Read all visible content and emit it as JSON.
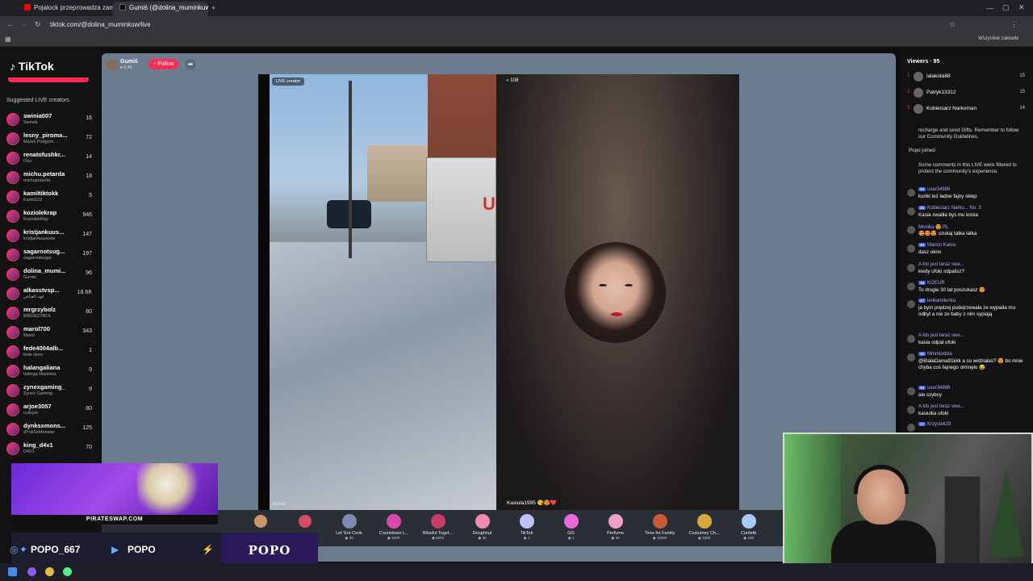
{
  "browser": {
    "tabs": [
      {
        "title": "Pojalock przeprowadza zamach...",
        "color": "#ff0000"
      },
      {
        "title": "Gumiś (@dolina_muminkuw)...",
        "color": "#000000"
      }
    ],
    "url": "tiktok.com/@dolina_muminkuw/live",
    "bookmarks_label": "Wszystkie zakładki"
  },
  "brand": {
    "logo": "TikTok",
    "accent": "#fe2c55"
  },
  "sidebar": {
    "title": "Suggested LIVE creators",
    "creators": [
      {
        "name": "swinia007",
        "sub": "Swinek",
        "count": "16"
      },
      {
        "name": "lesny_piroma...",
        "sub": "Marek Podgóm...",
        "count": "72"
      },
      {
        "name": "renatofushkr...",
        "sub": "Ooo",
        "count": "14"
      },
      {
        "name": "michu.petarda",
        "sub": "michupetarda",
        "count": "18"
      },
      {
        "name": "kamiltiktokk",
        "sub": "Kamil123",
        "count": "5"
      },
      {
        "name": "koziolekrap",
        "sub": "KoziolekRap",
        "count": "946"
      },
      {
        "name": "kristjankuus...",
        "sub": "kristjankuuseste",
        "count": "147"
      },
      {
        "name": "sagarnotsug...",
        "sub": "sagarnotsugar",
        "count": "197"
      },
      {
        "name": "dolina_mumi...",
        "sub": "Gumiś",
        "count": "96"
      },
      {
        "name": "alkasstvsp...",
        "sub": "فهد القناص",
        "count": "18.6K"
      },
      {
        "name": "mrgrzybolz",
        "sub": "MRGRZYBOL",
        "count": "80"
      },
      {
        "name": "marol700",
        "sub": "Marol",
        "count": "343"
      },
      {
        "name": "fede4004alb...",
        "sub": "fede vlore",
        "count": "1"
      },
      {
        "name": "halangaliana",
        "sub": "halinga Marinela",
        "count": "9"
      },
      {
        "name": "zynexgaming_",
        "sub": "Zynex Gaming",
        "count": "9"
      },
      {
        "name": "arjoe3057",
        "sub": "ᴄᴀArjoe",
        "count": "80"
      },
      {
        "name": "dynksxmons...",
        "sub": "dYnkSxMonster",
        "count": "125"
      },
      {
        "name": "king_d4v1",
        "sub": "D4V1",
        "count": "70"
      }
    ]
  },
  "stream": {
    "host_name": "Gumiś",
    "host_likes": "6.2K",
    "follow_label": "+ Follow",
    "live_badge": "LIVE creator",
    "left_tag": "Gumiś",
    "viewer_count": "108",
    "guest_name": "Kasiula1995 😘😍❤️"
  },
  "gifts": [
    {
      "name": "Let 'Em Cook",
      "price": "20",
      "color": "#7a8ab0"
    },
    {
      "name": "Countdown t...",
      "price": "2026",
      "color": "#d84ab0"
    },
    {
      "name": "Blissful Toget...",
      "price": "6202",
      "color": "#c83a6a"
    },
    {
      "name": "Doughnut",
      "price": "30",
      "color": "#f28ab0"
    },
    {
      "name": "TikTok",
      "price": "1",
      "color": "#c0c0ff"
    },
    {
      "name": "GG",
      "price": "1",
      "color": "#e86ad8"
    },
    {
      "name": "Perfume",
      "price": "20",
      "color": "#f2a0c8"
    },
    {
      "name": "Time for Family",
      "price": "15000",
      "color": "#c85a3a"
    },
    {
      "name": "Costumey Ch...",
      "price": "1500",
      "color": "#d8a83a"
    },
    {
      "name": "Confetti",
      "price": "100",
      "color": "#a8c8f8"
    }
  ],
  "viewers": {
    "title": "Viewers · 95",
    "top": [
      {
        "rank": "1",
        "name": "lalakota88",
        "count": "15"
      },
      {
        "rank": "2",
        "name": "Patryk13312",
        "count": "15"
      },
      {
        "rank": "3",
        "name": "Kobieciarz Narkoman",
        "count": "14"
      }
    ]
  },
  "chat": {
    "system_top": "recharge and send Gifts. Remember to follow our Community Guidelines.",
    "joined": "Popo  joined",
    "filter_notice": "Some comments in this LIVE were filtered to protect the community's experience.",
    "messages": [
      {
        "lvl": "45",
        "user": "user34986",
        "text": "kurtki też ładne fajny sklep"
      },
      {
        "lvl": "46",
        "user": "Kobieciarz Narko... No. 3",
        "text": "Kasia zwaliła byś mu konia"
      },
      {
        "lvl": "",
        "user": "Monika 😍 PL",
        "text": "😍😍😍 szukaj tatka latka"
      },
      {
        "lvl": "45",
        "user": "Marcin Kania",
        "text": "dasz okno"
      },
      {
        "lvl": "",
        "user": "A kto jest teraz swe...",
        "text": "kiedy ufoki odpalisz?"
      },
      {
        "lvl": "46",
        "user": "KOCUR",
        "text": "To drugie 30 lat poszukasz 😍"
      },
      {
        "lvl": "47",
        "user": "lenkamilenka",
        "text": "ja bym prędzej podejrzewała ze wypada mu odbyt a nie ze baby z nim sypiają"
      },
      {
        "lvl": "",
        "user": "A kto jest teraz swe...",
        "text": "kasia odpal ufoki"
      },
      {
        "lvl": "46",
        "user": "Mmmiodzia",
        "text": "@BiałaDama91kkk a co widziałaś? 😍 bo mnie chyba coś fajnego ominęło 😂"
      },
      {
        "lvl": "45",
        "user": "user34986",
        "text": "ale szybcy"
      },
      {
        "lvl": "",
        "user": "A kto jest teraz swe...",
        "text": "kasiulka ufoki"
      },
      {
        "lvl": "12",
        "user": "Krzysiek19",
        "text": ""
      }
    ]
  },
  "overlay": {
    "sponsor": "PIRATESWAP.COM",
    "social_handle": "POPO_667",
    "youtube_handle": "POPO",
    "brand_name": "POPO"
  }
}
